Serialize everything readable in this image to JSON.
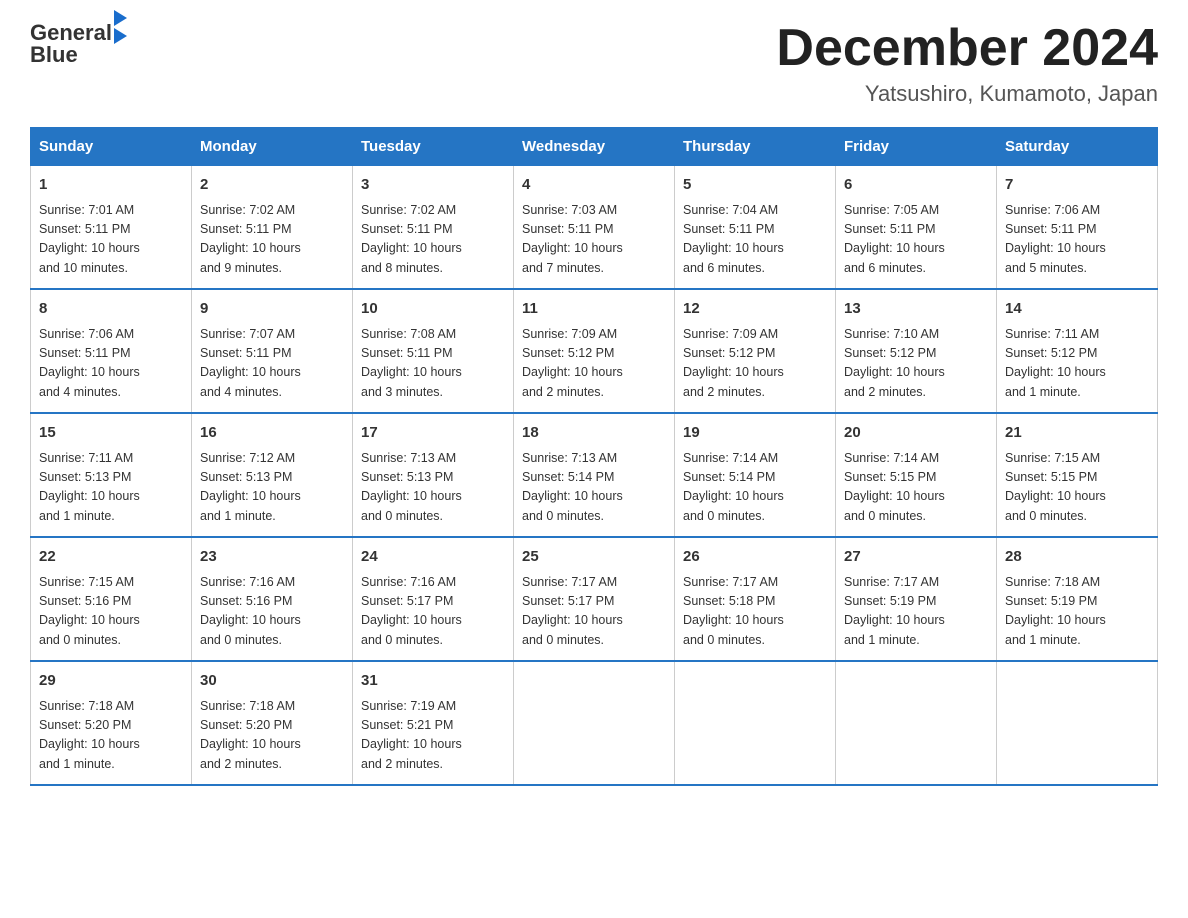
{
  "header": {
    "logo_text1": "General",
    "logo_text2": "Blue",
    "month_title": "December 2024",
    "location": "Yatsushiro, Kumamoto, Japan"
  },
  "days_of_week": [
    "Sunday",
    "Monday",
    "Tuesday",
    "Wednesday",
    "Thursday",
    "Friday",
    "Saturday"
  ],
  "weeks": [
    [
      {
        "day": "1",
        "sunrise": "7:01 AM",
        "sunset": "5:11 PM",
        "daylight": "10 hours and 10 minutes."
      },
      {
        "day": "2",
        "sunrise": "7:02 AM",
        "sunset": "5:11 PM",
        "daylight": "10 hours and 9 minutes."
      },
      {
        "day": "3",
        "sunrise": "7:02 AM",
        "sunset": "5:11 PM",
        "daylight": "10 hours and 8 minutes."
      },
      {
        "day": "4",
        "sunrise": "7:03 AM",
        "sunset": "5:11 PM",
        "daylight": "10 hours and 7 minutes."
      },
      {
        "day": "5",
        "sunrise": "7:04 AM",
        "sunset": "5:11 PM",
        "daylight": "10 hours and 6 minutes."
      },
      {
        "day": "6",
        "sunrise": "7:05 AM",
        "sunset": "5:11 PM",
        "daylight": "10 hours and 6 minutes."
      },
      {
        "day": "7",
        "sunrise": "7:06 AM",
        "sunset": "5:11 PM",
        "daylight": "10 hours and 5 minutes."
      }
    ],
    [
      {
        "day": "8",
        "sunrise": "7:06 AM",
        "sunset": "5:11 PM",
        "daylight": "10 hours and 4 minutes."
      },
      {
        "day": "9",
        "sunrise": "7:07 AM",
        "sunset": "5:11 PM",
        "daylight": "10 hours and 4 minutes."
      },
      {
        "day": "10",
        "sunrise": "7:08 AM",
        "sunset": "5:11 PM",
        "daylight": "10 hours and 3 minutes."
      },
      {
        "day": "11",
        "sunrise": "7:09 AM",
        "sunset": "5:12 PM",
        "daylight": "10 hours and 2 minutes."
      },
      {
        "day": "12",
        "sunrise": "7:09 AM",
        "sunset": "5:12 PM",
        "daylight": "10 hours and 2 minutes."
      },
      {
        "day": "13",
        "sunrise": "7:10 AM",
        "sunset": "5:12 PM",
        "daylight": "10 hours and 2 minutes."
      },
      {
        "day": "14",
        "sunrise": "7:11 AM",
        "sunset": "5:12 PM",
        "daylight": "10 hours and 1 minute."
      }
    ],
    [
      {
        "day": "15",
        "sunrise": "7:11 AM",
        "sunset": "5:13 PM",
        "daylight": "10 hours and 1 minute."
      },
      {
        "day": "16",
        "sunrise": "7:12 AM",
        "sunset": "5:13 PM",
        "daylight": "10 hours and 1 minute."
      },
      {
        "day": "17",
        "sunrise": "7:13 AM",
        "sunset": "5:13 PM",
        "daylight": "10 hours and 0 minutes."
      },
      {
        "day": "18",
        "sunrise": "7:13 AM",
        "sunset": "5:14 PM",
        "daylight": "10 hours and 0 minutes."
      },
      {
        "day": "19",
        "sunrise": "7:14 AM",
        "sunset": "5:14 PM",
        "daylight": "10 hours and 0 minutes."
      },
      {
        "day": "20",
        "sunrise": "7:14 AM",
        "sunset": "5:15 PM",
        "daylight": "10 hours and 0 minutes."
      },
      {
        "day": "21",
        "sunrise": "7:15 AM",
        "sunset": "5:15 PM",
        "daylight": "10 hours and 0 minutes."
      }
    ],
    [
      {
        "day": "22",
        "sunrise": "7:15 AM",
        "sunset": "5:16 PM",
        "daylight": "10 hours and 0 minutes."
      },
      {
        "day": "23",
        "sunrise": "7:16 AM",
        "sunset": "5:16 PM",
        "daylight": "10 hours and 0 minutes."
      },
      {
        "day": "24",
        "sunrise": "7:16 AM",
        "sunset": "5:17 PM",
        "daylight": "10 hours and 0 minutes."
      },
      {
        "day": "25",
        "sunrise": "7:17 AM",
        "sunset": "5:17 PM",
        "daylight": "10 hours and 0 minutes."
      },
      {
        "day": "26",
        "sunrise": "7:17 AM",
        "sunset": "5:18 PM",
        "daylight": "10 hours and 0 minutes."
      },
      {
        "day": "27",
        "sunrise": "7:17 AM",
        "sunset": "5:19 PM",
        "daylight": "10 hours and 1 minute."
      },
      {
        "day": "28",
        "sunrise": "7:18 AM",
        "sunset": "5:19 PM",
        "daylight": "10 hours and 1 minute."
      }
    ],
    [
      {
        "day": "29",
        "sunrise": "7:18 AM",
        "sunset": "5:20 PM",
        "daylight": "10 hours and 1 minute."
      },
      {
        "day": "30",
        "sunrise": "7:18 AM",
        "sunset": "5:20 PM",
        "daylight": "10 hours and 2 minutes."
      },
      {
        "day": "31",
        "sunrise": "7:19 AM",
        "sunset": "5:21 PM",
        "daylight": "10 hours and 2 minutes."
      },
      null,
      null,
      null,
      null
    ]
  ],
  "labels": {
    "sunrise": "Sunrise:",
    "sunset": "Sunset:",
    "daylight": "Daylight:"
  }
}
